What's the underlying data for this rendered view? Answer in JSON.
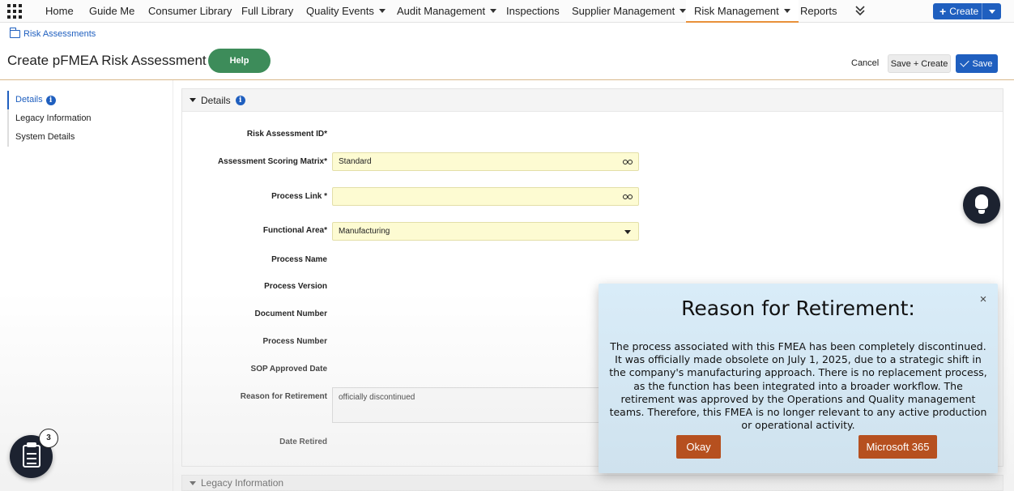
{
  "nav": {
    "items": [
      {
        "label": "Home",
        "caret": false
      },
      {
        "label": "Guide Me",
        "caret": false
      },
      {
        "label": "Consumer Library",
        "caret": false
      },
      {
        "label": "Full Library",
        "caret": false
      },
      {
        "label": "Quality Events",
        "caret": true
      },
      {
        "label": "Audit Management",
        "caret": true
      },
      {
        "label": "Inspections",
        "caret": false
      },
      {
        "label": "Supplier Management",
        "caret": true
      },
      {
        "label": "Risk Management",
        "caret": true,
        "active": true
      },
      {
        "label": "Reports",
        "caret": false
      }
    ],
    "more_icon": "double-chevron-down-icon",
    "create_label": "Create"
  },
  "breadcrumb": {
    "label": "Risk Assessments",
    "icon": "folder-icon"
  },
  "header": {
    "title": "Create pFMEA Risk Assessment",
    "help_label": "Help",
    "cancel_label": "Cancel",
    "save_create_label": "Save + Create",
    "save_label": "Save"
  },
  "sidenav": {
    "items": [
      {
        "label": "Details",
        "info": true
      },
      {
        "label": "Legacy Information",
        "info": false
      },
      {
        "label": "System Details",
        "info": false
      }
    ]
  },
  "form": {
    "section_title": "Details",
    "fields": {
      "risk_id": {
        "label": "Risk Assessment ID*"
      },
      "scoring_matrix": {
        "label": "Assessment Scoring Matrix*",
        "value": "Standard"
      },
      "process_link": {
        "label": "Process Link *",
        "value": ""
      },
      "functional_area": {
        "label": "Functional Area*",
        "value": "Manufacturing"
      },
      "process_name": {
        "label": "Process Name"
      },
      "process_version": {
        "label": "Process Version"
      },
      "document_number": {
        "label": "Document Number"
      },
      "process_number": {
        "label": "Process Number"
      },
      "sop_date": {
        "label": "SOP Approved Date"
      },
      "reason_retirement": {
        "label": "Reason for Retirement",
        "value": "officially discontinued"
      },
      "date_retired": {
        "label": "Date Retired"
      }
    },
    "section2_title": "Legacy Information"
  },
  "badge_count": "3",
  "modal": {
    "title": "Reason for Retirement:",
    "body": "The process associated with this FMEA has been completely discontinued. It was officially made obsolete on July 1, 2025, due to a strategic shift in the company's manufacturing approach. There is no replacement process, as the function has been integrated into a broader workflow. The retirement was approved by the Operations and Quality management teams. Therefore, this FMEA is no longer relevant to any active production or operational activity.",
    "close_glyph": "×",
    "okay_label": "Okay",
    "ms_label": "Microsoft 365"
  },
  "colors": {
    "primary": "#1f5fbf",
    "help_green": "#3d8c5a",
    "modal_button": "#b6501f",
    "input_yellow": "#fdfbd2",
    "active_tab_underline": "#e8913a"
  }
}
